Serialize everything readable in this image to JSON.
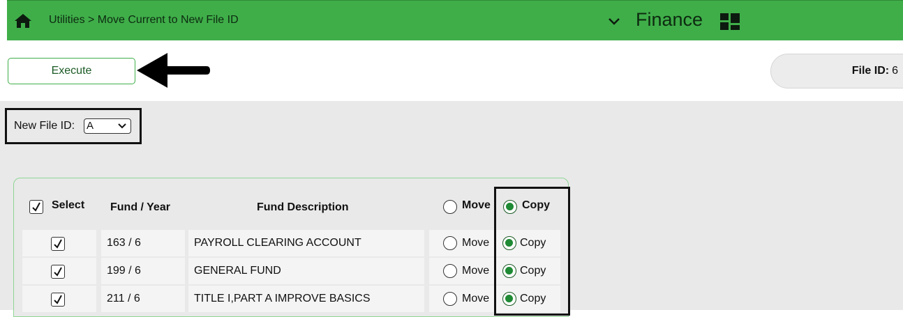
{
  "header": {
    "breadcrumb": "Utilities > Move Current to New File ID",
    "module": "Finance",
    "icons": [
      "home-icon",
      "chevron-down-icon",
      "grid-icon"
    ],
    "accent_color": "#3fae49"
  },
  "toolbar": {
    "execute_label": "Execute",
    "file_id_label": "File ID:",
    "file_id_value": "6"
  },
  "form": {
    "new_file_id_label": "New File ID:",
    "new_file_id_value": "A"
  },
  "table": {
    "select_all_label": "Select",
    "select_all_checked": true,
    "columns": [
      "Fund / Year",
      "Fund Description"
    ],
    "header_move_label": "Move",
    "header_copy_label": "Copy",
    "header_selected": "Copy",
    "rows": [
      {
        "selected": true,
        "fund_year": "163 / 6",
        "description": "PAYROLL CLEARING ACCOUNT",
        "move_label": "Move",
        "copy_label": "Copy",
        "action": "Copy"
      },
      {
        "selected": true,
        "fund_year": "199 / 6",
        "description": "GENERAL FUND",
        "move_label": "Move",
        "copy_label": "Copy",
        "action": "Copy"
      },
      {
        "selected": true,
        "fund_year": "211 / 6",
        "description": "TITLE I,PART A IMPROVE BASICS",
        "move_label": "Move",
        "copy_label": "Copy",
        "action": "Copy"
      }
    ]
  }
}
